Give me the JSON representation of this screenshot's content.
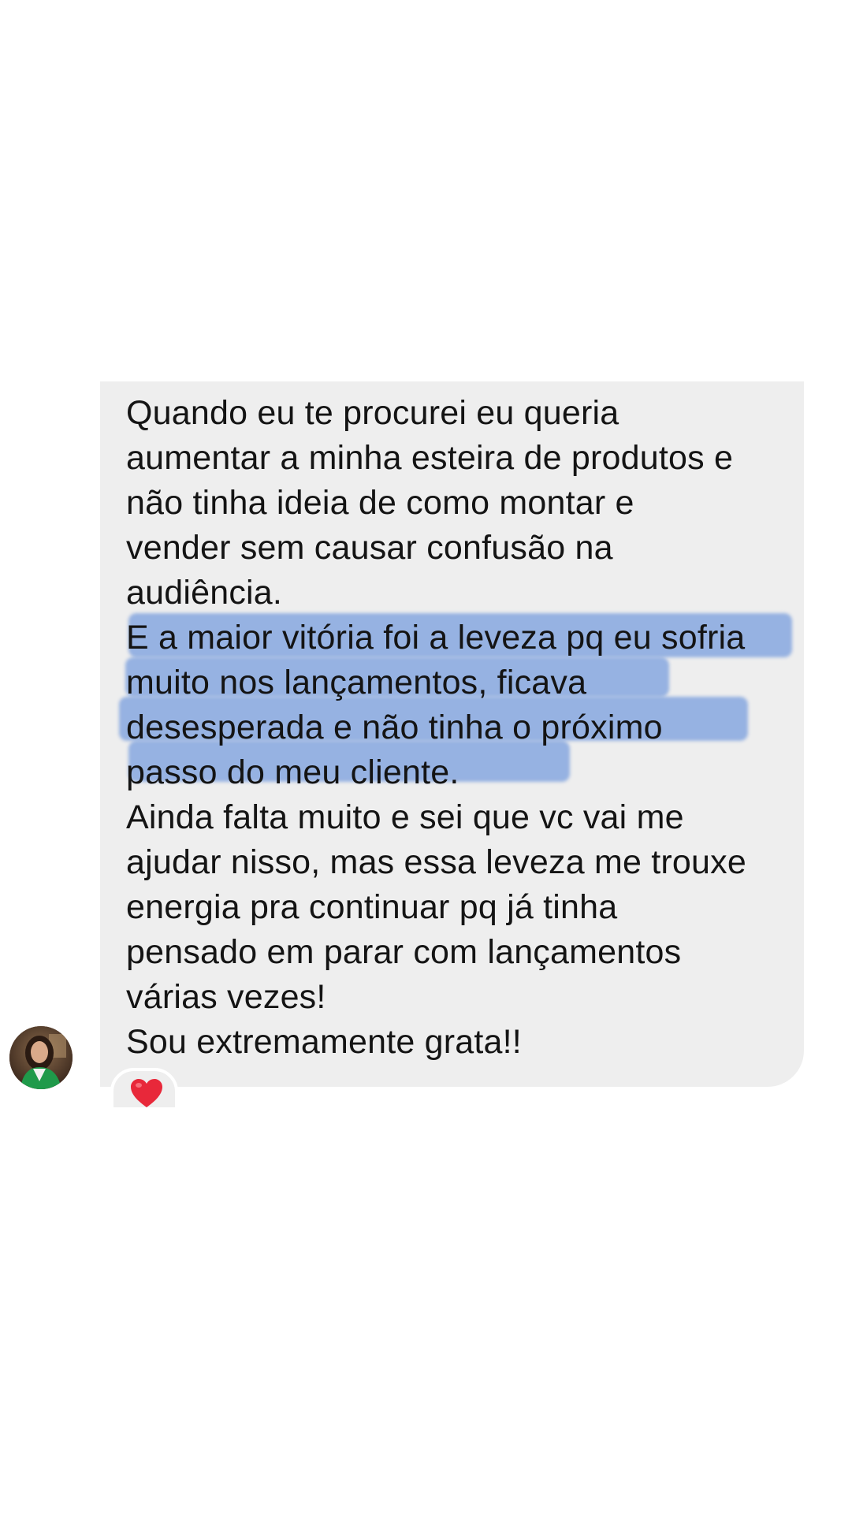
{
  "message": {
    "paragraph1": [
      "Quando eu te procurei eu queria",
      "aumentar a minha esteira de produtos e",
      "não tinha ideia de como montar e",
      "vender sem causar confusão na",
      "audiência."
    ],
    "paragraph2": [
      "E a maior vitória foi a leveza pq eu sofria",
      "muito nos lançamentos, ficava",
      "desesperada e não tinha o próximo",
      "passo do meu cliente."
    ],
    "paragraph3": [
      "Ainda falta muito e sei que vc vai me",
      "ajudar nisso, mas essa leveza me trouxe",
      "energia pra continuar pq já tinha",
      "pensado em parar com lançamentos",
      "várias vezes!"
    ],
    "paragraph4": [
      "Sou extremamente grata!!"
    ]
  },
  "reaction": {
    "icon": "heart-icon",
    "color": "#e8283a"
  },
  "avatar": {
    "icon": "sender-avatar"
  },
  "colors": {
    "bubble": "#eeeeee",
    "text": "#141414",
    "highlight": "#608cda"
  }
}
